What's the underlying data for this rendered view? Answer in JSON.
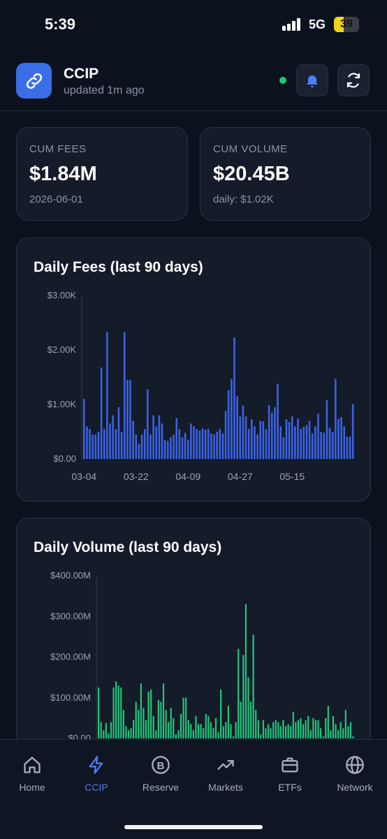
{
  "status_bar": {
    "time": "5:39",
    "network": "5G",
    "battery": "39",
    "battery_level": 0.39
  },
  "header": {
    "title": "CCIP",
    "subtitle": "updated 1m ago",
    "app_icon": "link-icon",
    "status_color": "#22c57a"
  },
  "stats": [
    {
      "label": "CUM FEES",
      "value": "$1.84M",
      "sub": "2026-06-01"
    },
    {
      "label": "CUM VOLUME",
      "value": "$20.45B",
      "sub": "daily: $1.02K"
    }
  ],
  "chart_data": [
    {
      "type": "bar",
      "title": "Daily Fees (last 90 days)",
      "ytick_labels": [
        "$0.00",
        "$1.00K",
        "$2.00K",
        "$3.00K"
      ],
      "ylim": [
        0,
        3000
      ],
      "xtick_labels": [
        "03-04",
        "03-22",
        "04-09",
        "04-27",
        "05-15"
      ],
      "xtick_index": [
        0,
        18,
        36,
        54,
        72
      ],
      "color": "#3b63e6",
      "values": [
        1100,
        600,
        550,
        450,
        450,
        500,
        1680,
        550,
        2330,
        650,
        800,
        550,
        950,
        500,
        2330,
        1450,
        1450,
        700,
        450,
        280,
        450,
        550,
        1280,
        450,
        800,
        600,
        800,
        650,
        350,
        330,
        400,
        450,
        750,
        550,
        400,
        480,
        350,
        650,
        600,
        550,
        520,
        560,
        540,
        550,
        470,
        450,
        500,
        550,
        470,
        880,
        1260,
        1470,
        2230,
        1150,
        780,
        980,
        780,
        550,
        730,
        600,
        450,
        700,
        690,
        550,
        990,
        850,
        950,
        1380,
        600,
        400,
        730,
        680,
        780,
        600,
        740,
        550,
        590,
        620,
        700,
        470,
        600,
        830,
        500,
        480,
        1080,
        570,
        500,
        1470,
        740,
        770,
        600,
        410,
        410,
        1010
      ]
    },
    {
      "type": "bar",
      "title": "Daily Volume (last 90 days)",
      "ytick_labels": [
        "$0.00",
        "$100.00M",
        "$200.00M",
        "$300.00M",
        "$400.00M"
      ],
      "ylim": [
        0,
        400
      ],
      "color": "#22c57a",
      "values": [
        125,
        40,
        20,
        38,
        12,
        40,
        125,
        140,
        130,
        125,
        70,
        30,
        20,
        25,
        45,
        90,
        70,
        135,
        75,
        45,
        115,
        120,
        55,
        20,
        95,
        90,
        135,
        70,
        40,
        75,
        50,
        10,
        20,
        60,
        100,
        100,
        45,
        35,
        20,
        55,
        35,
        35,
        25,
        60,
        55,
        40,
        25,
        50,
        15,
        120,
        30,
        40,
        80,
        35,
        5,
        40,
        220,
        90,
        205,
        330,
        150,
        90,
        255,
        70,
        45,
        10,
        45,
        25,
        35,
        25,
        40,
        45,
        40,
        30,
        45,
        30,
        35,
        30,
        65,
        40,
        45,
        50,
        35,
        45,
        55,
        20,
        50,
        45,
        45,
        25,
        5,
        50,
        80,
        20,
        55,
        35,
        20,
        40,
        25,
        70,
        30,
        40,
        5
      ]
    }
  ],
  "nav": [
    {
      "label": "Home",
      "icon": "home-icon",
      "active": false
    },
    {
      "label": "CCIP",
      "icon": "lightning-icon",
      "active": true
    },
    {
      "label": "Reserve",
      "icon": "coin-b-icon",
      "active": false
    },
    {
      "label": "Markets",
      "icon": "trending-up-icon",
      "active": false
    },
    {
      "label": "ETFs",
      "icon": "briefcase-icon",
      "active": false
    },
    {
      "label": "Network",
      "icon": "globe-icon",
      "active": false
    }
  ]
}
